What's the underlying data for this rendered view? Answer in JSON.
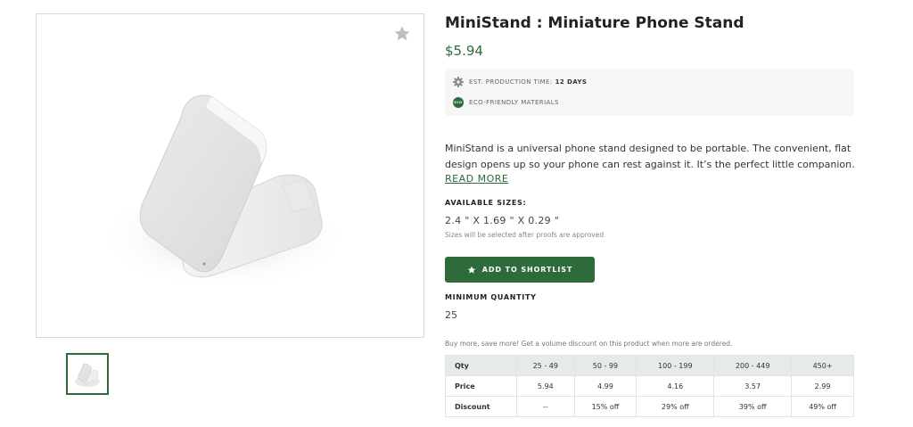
{
  "product": {
    "title": "MiniStand : Miniature Phone Stand",
    "price": "$5.94"
  },
  "info": {
    "production_label": "EST. PRODUCTION TIME:",
    "production_value": "12 DAYS",
    "eco_badge": "ECO",
    "eco_label": "ECO-FRIENDLY MATERIALS"
  },
  "description": {
    "line1": "MiniStand is a universal phone stand designed to be portable.  The convenient, flat",
    "line2": "design opens up so your phone can rest against it.  It’s the perfect little companion…",
    "read_more": "READ MORE"
  },
  "sizes": {
    "label": "AVAILABLE SIZES:",
    "value": "2.4 \" X 1.69 \" X 0.29 \"",
    "note": "Sizes will be selected after proofs are approved"
  },
  "shortlist": {
    "label": "ADD TO SHORTLIST"
  },
  "min_quantity": {
    "label": "MINIMUM QUANTITY",
    "value": "25"
  },
  "volume": {
    "note": "Buy more, save more! Get a volume discount on this product when more are ordered.",
    "headers": [
      "Qty",
      "25 - 49",
      "50 - 99",
      "100 - 199",
      "200 - 449",
      "450+"
    ],
    "price_row": [
      "Price",
      "5.94",
      "4.99",
      "4.16",
      "3.57",
      "2.99"
    ],
    "discount_row": [
      "Discount",
      "--",
      "15% off",
      "29% off",
      "39% off",
      "49% off"
    ]
  },
  "icons": {
    "favorite": "star-icon",
    "production": "gear-icon",
    "eco": "eco-badge-icon",
    "shortlist": "star-icon"
  },
  "colors": {
    "brand_green": "#2e6b3a",
    "table_header_bg": "#e6ebe7",
    "info_box_bg": "#f6f6f6"
  }
}
